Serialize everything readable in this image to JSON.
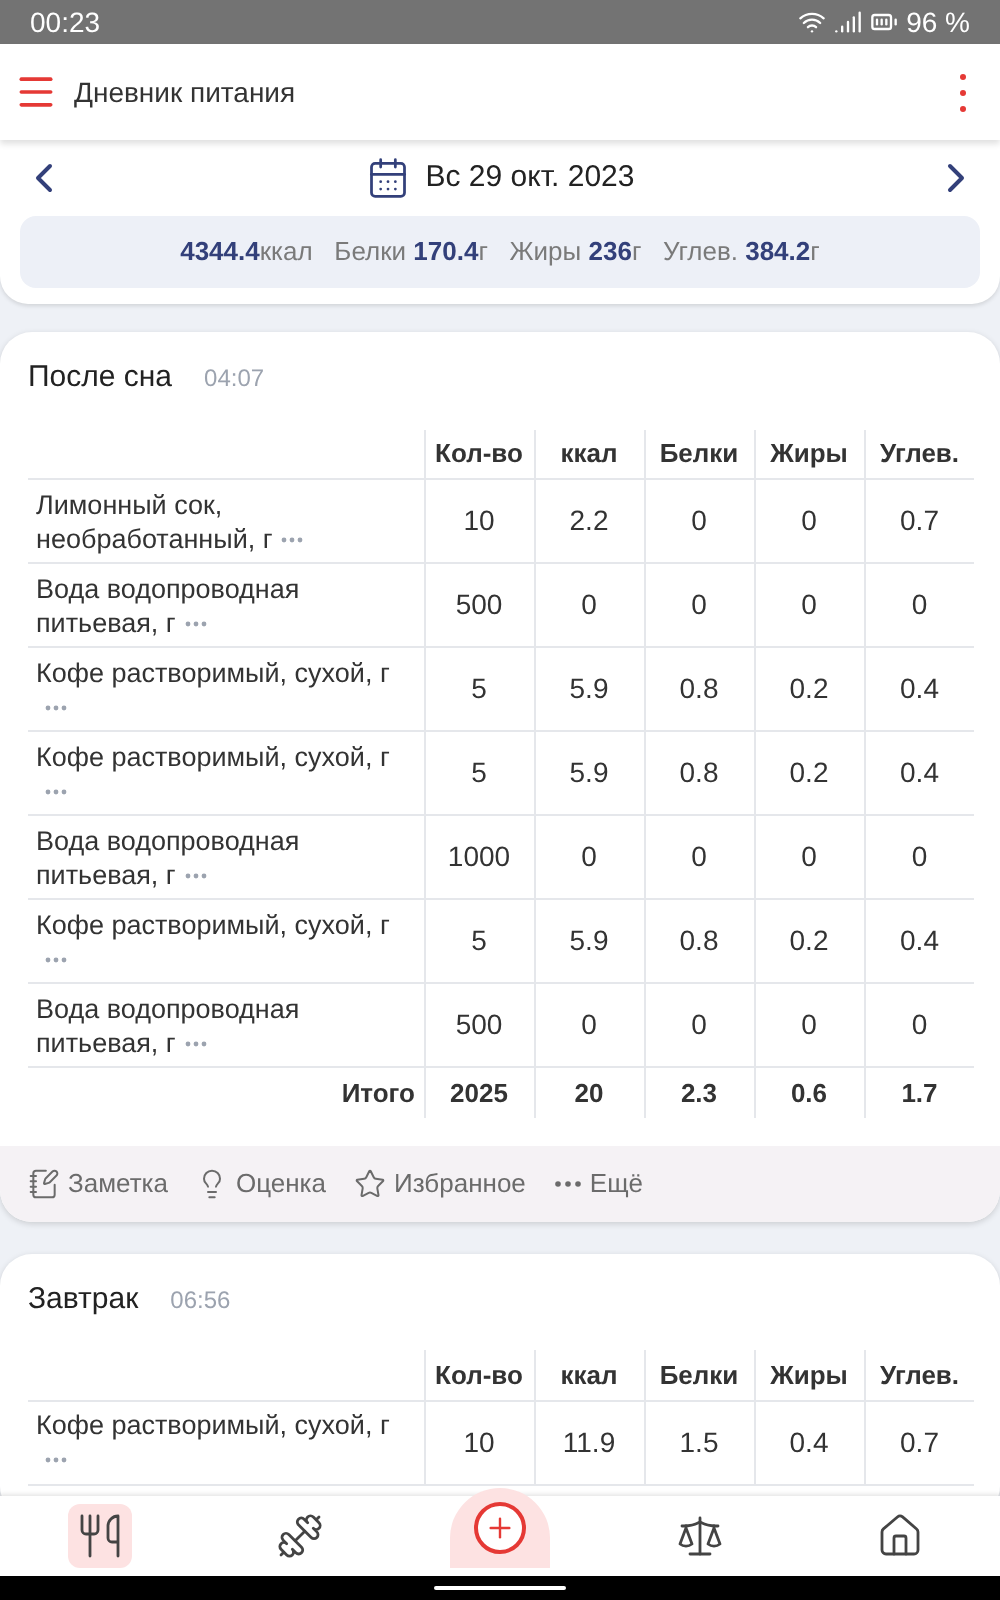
{
  "status_bar": {
    "time": "00:23",
    "battery": "96 %"
  },
  "app_bar": {
    "title": "Дневник питания"
  },
  "date_nav": {
    "date": "Вс 29 окт. 2023"
  },
  "summary": "**4344.4**ккал   Белки **170.4**г   Жиры **236**г   Углев. **384.2**г",
  "meals": [
    {
      "name": "После сна",
      "time": "04:07",
      "columns": [
        "Кол-во",
        "ккал",
        "Белки",
        "Жиры",
        "Углев."
      ],
      "rows": [
        {
          "food": "Лимонный сок, необработанный, г",
          "values": [
            "10",
            "2.2",
            "0",
            "0",
            "0.7"
          ]
        },
        {
          "food": "Вода водопроводная питьевая, г",
          "values": [
            "500",
            "0",
            "0",
            "0",
            "0"
          ]
        },
        {
          "food": "Кофе растворимый, сухой, г",
          "values": [
            "5",
            "5.9",
            "0.8",
            "0.2",
            "0.4"
          ]
        },
        {
          "food": "Кофе растворимый, сухой, г",
          "values": [
            "5",
            "5.9",
            "0.8",
            "0.2",
            "0.4"
          ]
        },
        {
          "food": "Вода водопроводная питьевая, г",
          "values": [
            "1000",
            "0",
            "0",
            "0",
            "0"
          ]
        },
        {
          "food": "Кофе растворимый, сухой, г",
          "values": [
            "5",
            "5.9",
            "0.8",
            "0.2",
            "0.4"
          ]
        },
        {
          "food": "Вода водопроводная питьевая, г",
          "values": [
            "500",
            "0",
            "0",
            "0",
            "0"
          ]
        }
      ],
      "total": {
        "label": "Итого",
        "values": [
          "2025",
          "20",
          "2.3",
          "0.6",
          "1.7"
        ]
      },
      "actions": [
        {
          "kind": "note",
          "label": "Заметка"
        },
        {
          "kind": "rate",
          "label": "Оценка"
        },
        {
          "kind": "favorite",
          "label": "Избранное"
        },
        {
          "kind": "more",
          "label": "Ещё"
        }
      ]
    },
    {
      "name": "Завтрак",
      "time": "06:56",
      "columns": [
        "Кол-во",
        "ккал",
        "Белки",
        "Жиры",
        "Углев."
      ],
      "rows": [
        {
          "food": "Кофе растворимый, сухой, г",
          "values": [
            "10",
            "11.9",
            "1.5",
            "0.4",
            "0.7"
          ]
        }
      ]
    }
  ],
  "bottom_nav": [
    {
      "kind": "food",
      "selected": true
    },
    {
      "kind": "exercise",
      "selected": false
    },
    {
      "kind": "add",
      "selected": false
    },
    {
      "kind": "scale",
      "selected": false
    },
    {
      "kind": "home",
      "selected": false
    }
  ]
}
